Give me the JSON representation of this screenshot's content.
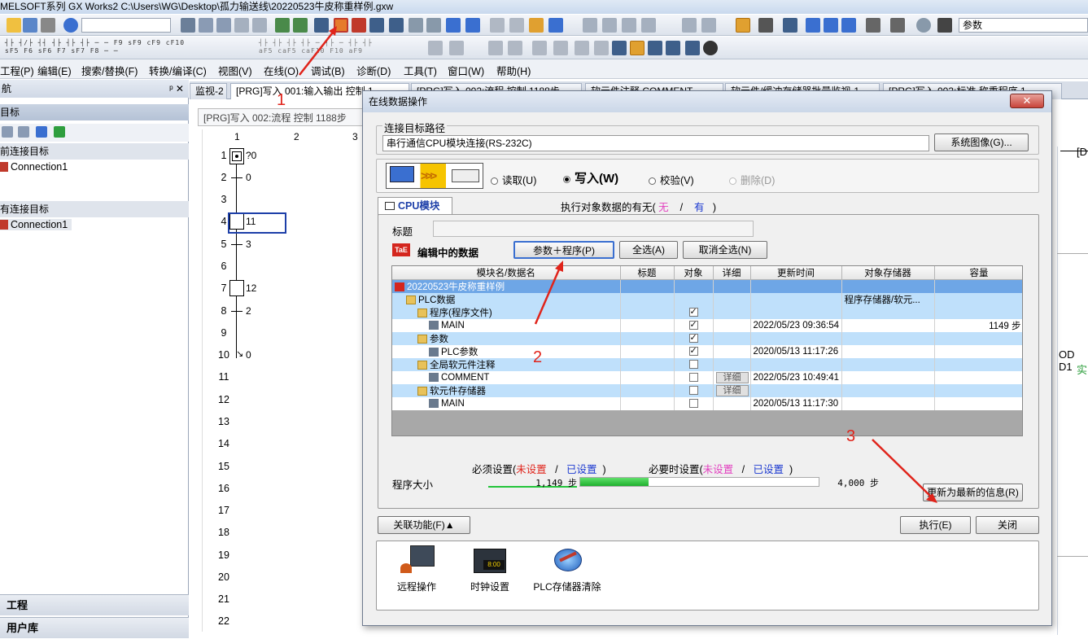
{
  "window": {
    "title": "MELSOFT系列 GX Works2 C:\\Users\\WG\\Desktop\\孤力输送线\\20220523牛皮称重样例.gxw"
  },
  "toolbar": {
    "search_value": "参数"
  },
  "menu": [
    "工程(P)",
    "编辑(E)",
    "搜索/替换(F)",
    "转换/编译(C)",
    "视图(V)",
    "在线(O)",
    "调试(B)",
    "诊断(D)",
    "工具(T)",
    "窗口(W)",
    "帮助(H)"
  ],
  "nav": {
    "title": "航",
    "pin": "ᵖ ✕",
    "target_label": "目标",
    "current_target_label": "前连接目标",
    "current_conn": "Connection1",
    "all_target_label": "有连接目标",
    "all_conn": "Connection1",
    "bottom_sections": [
      "工程",
      "用户库"
    ]
  },
  "tabs": [
    "监视-2",
    "[PRG]写入 001:输入输出 控制 1...",
    "[PRG]写入 002:流程 控制 1188步",
    "软元件注释 COMMENT",
    "软元件/缓冲存储器批量监视-1",
    "[PRG]写入 003:标准 称重程序 1..."
  ],
  "editor": {
    "subtab": "[PRG]写入 002:流程 控制 1188步",
    "col_headers": [
      "1",
      "2",
      "3"
    ],
    "rows": [
      "1",
      "2",
      "3",
      "4",
      "5",
      "6",
      "7",
      "8",
      "9",
      "10",
      "11",
      "12",
      "13",
      "14",
      "15",
      "16",
      "17",
      "18",
      "19",
      "20",
      "21",
      "22"
    ],
    "sfc_labels": [
      "?0",
      "0",
      "11",
      "3",
      "12",
      "2",
      "0"
    ],
    "right_side": [
      "[D",
      "OD  D1",
      "实"
    ]
  },
  "dialog": {
    "title": "在线数据操作",
    "close": "✕",
    "route_group": "连接目标路径",
    "route_value": "串行通信CPU模块连接(RS-232C)",
    "system_image_btn": "系统图像(G)...",
    "ops": [
      "读取(U)",
      "写入(W)",
      "校验(V)",
      "删除(D)"
    ],
    "selected_op": "写入(W)",
    "cpu_tab": "CPU模块",
    "exist_label": "执行对象数据的有无(",
    "exist_none": "无",
    "exist_slash": "/",
    "exist_yes": "有",
    "exist_end": ")",
    "title_label": "标题",
    "title_value": "",
    "editing_label": "编辑中的数据",
    "btn_param_prog": "参数＋程序(P)",
    "btn_select_all": "全选(A)",
    "btn_deselect_all": "取消全选(N)",
    "columns": [
      "模块名/数据名",
      "标题",
      "对象",
      "详细",
      "更新时间",
      "对象存储器",
      "容量"
    ],
    "rows": [
      {
        "name": "20220523牛皮称重样例",
        "kind": "root",
        "check": null,
        "detail": false,
        "time": "",
        "mem": "",
        "size": ""
      },
      {
        "name": "PLC数据",
        "kind": "grp",
        "check": null,
        "detail": false,
        "time": "",
        "mem": "程序存储器/软元...",
        "size": ""
      },
      {
        "name": "程序(程序文件)",
        "kind": "grp",
        "check": true,
        "detail": false,
        "time": "",
        "mem": "",
        "size": ""
      },
      {
        "name": "MAIN",
        "kind": "item",
        "check": true,
        "detail": false,
        "time": "2022/05/23 09:36:54",
        "mem": "",
        "size": "1149 步"
      },
      {
        "name": "参数",
        "kind": "grp",
        "check": true,
        "detail": false,
        "time": "",
        "mem": "",
        "size": ""
      },
      {
        "name": "PLC参数",
        "kind": "item",
        "check": true,
        "detail": false,
        "time": "2020/05/13 11:17:26",
        "mem": "",
        "size": ""
      },
      {
        "name": "全局软元件注释",
        "kind": "grp",
        "check": false,
        "detail": false,
        "time": "",
        "mem": "",
        "size": ""
      },
      {
        "name": "COMMENT",
        "kind": "item",
        "check": false,
        "detail": true,
        "time": "2022/05/23 10:49:41",
        "mem": "",
        "size": ""
      },
      {
        "name": "软元件存储器",
        "kind": "grp",
        "check": false,
        "detail": true,
        "time": "",
        "mem": "",
        "size": ""
      },
      {
        "name": "MAIN",
        "kind": "item",
        "check": false,
        "detail": false,
        "time": "2020/05/13 11:17:30",
        "mem": "",
        "size": ""
      }
    ],
    "detail_label": "详细",
    "req_label": "必须设置(",
    "req_unset": "未设置",
    "req_slash": "/",
    "req_set": "已设置",
    "req_end": ")",
    "opt_label": "必要时设置(",
    "opt_unset": "未设置",
    "opt_slash": "/",
    "opt_set": "已设置",
    "opt_end": ")",
    "prog_size_label": "程序大小",
    "prog_used": "1,149 步",
    "prog_total": "4,000 步",
    "prog_fill_ratio": 0.287,
    "refresh_btn": "更新为最新的信息(R)",
    "related_btn": "关联功能(F)▲",
    "execute_btn": "执行(E)",
    "close_btn": "关闭",
    "related_items": [
      "远程操作",
      "时钟设置",
      "PLC存储器清除"
    ],
    "clock_digits": "8:00"
  },
  "annotations": [
    "1",
    "2",
    "3"
  ],
  "colors": {
    "annotation": "#e0241b",
    "root_row": "#6ea6e6",
    "group_row": "#bfe0fb",
    "progress": "#22c43a",
    "unset": "#e23fbf",
    "set": "#1b39d0"
  }
}
